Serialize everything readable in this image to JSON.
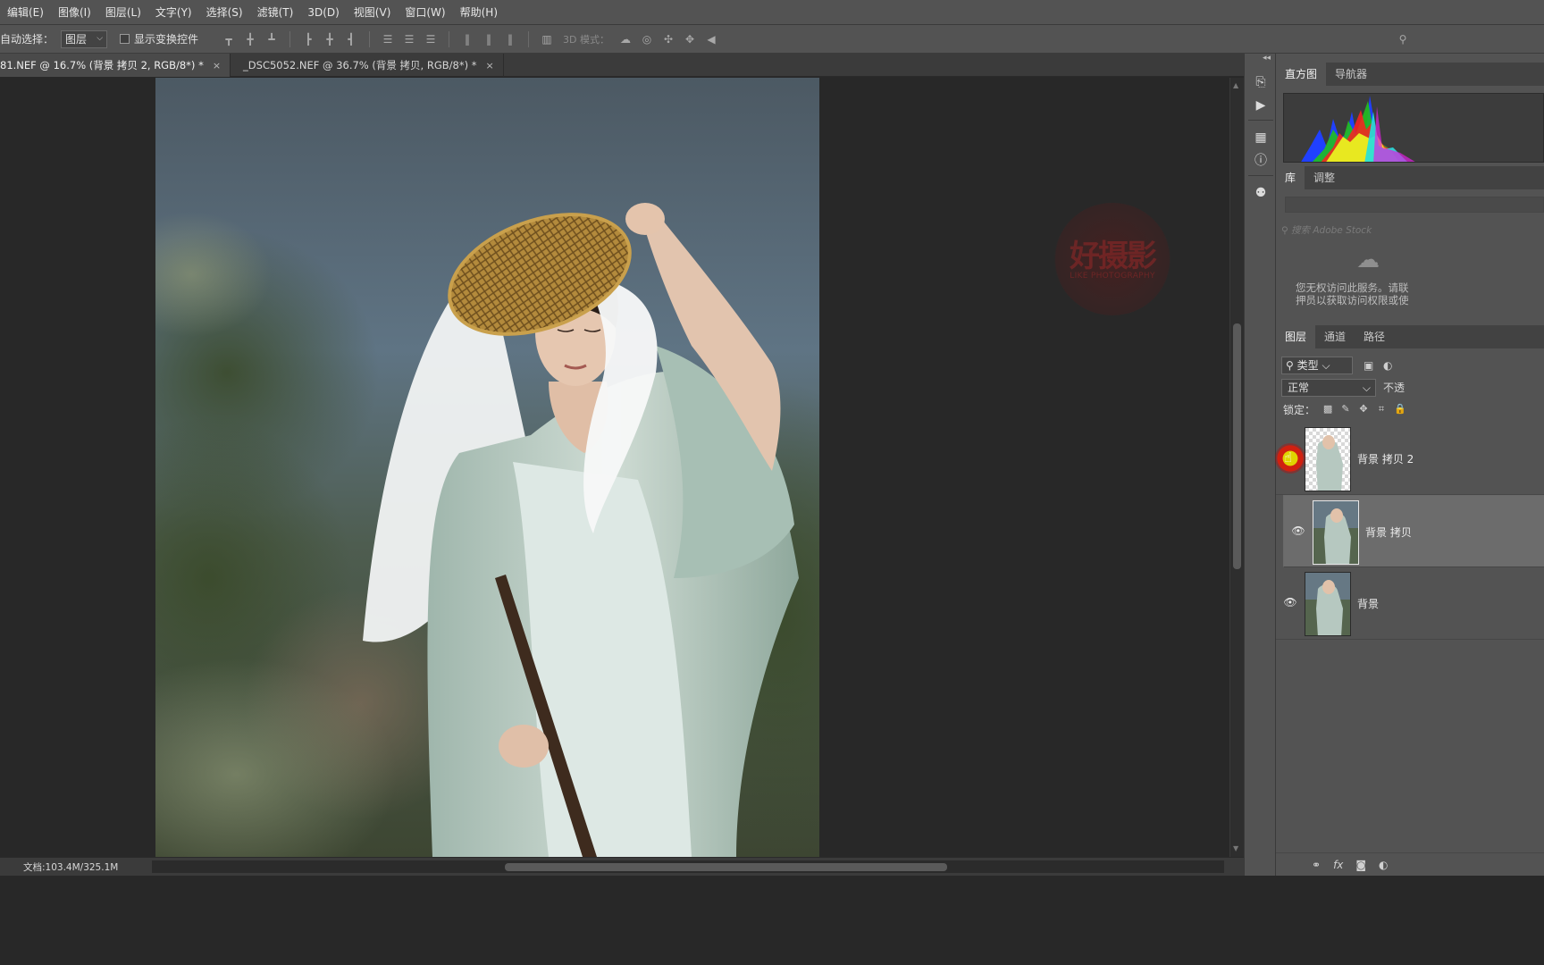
{
  "menu": [
    "编辑(E)",
    "图像(I)",
    "图层(L)",
    "文字(Y)",
    "选择(S)",
    "滤镜(T)",
    "3D(D)",
    "视图(V)",
    "窗口(W)",
    "帮助(H)"
  ],
  "options": {
    "auto_select_label": "自动选择：",
    "auto_select_value": "图层",
    "show_transform_label": "显示变换控件",
    "mode_3d_label": "3D 模式："
  },
  "tabs": [
    {
      "label": "81.NEF @ 16.7% (背景 拷贝 2, RGB/8*) *",
      "close": "×"
    },
    {
      "label": "_DSC5052.NEF @ 36.7% (背景 拷贝, RGB/8*) *",
      "close": "×"
    }
  ],
  "status": {
    "doc": "文档:103.4M/325.1M",
    "arrow": "〉"
  },
  "watermark": {
    "title": "好摄影",
    "subtitle": "LIKE PHOTOGRAPHY"
  },
  "panels": {
    "top_tabs": [
      "直方图",
      "导航器"
    ],
    "lib_tabs": [
      "库",
      "调整"
    ],
    "lib_search_placeholder": "搜索 Adobe Stock",
    "lib_message_1": "您无权访问此服务。请联",
    "lib_message_2": "押员以获取访问权限或使",
    "layer_tabs": [
      "图层",
      "通道",
      "路径"
    ],
    "filter_kind": "类型",
    "blend_mode": "正常",
    "opacity_label": "不透",
    "lock_label": "锁定："
  },
  "layers": [
    {
      "name": "背景 拷贝 2",
      "visible": false,
      "transparent": true
    },
    {
      "name": "背景 拷贝",
      "visible": true,
      "selected": true
    },
    {
      "name": "背景",
      "visible": true
    }
  ],
  "colors": {
    "ui_bg": "#535353",
    "canvas_bg": "#282828",
    "cursor_ring": "#d02010"
  }
}
